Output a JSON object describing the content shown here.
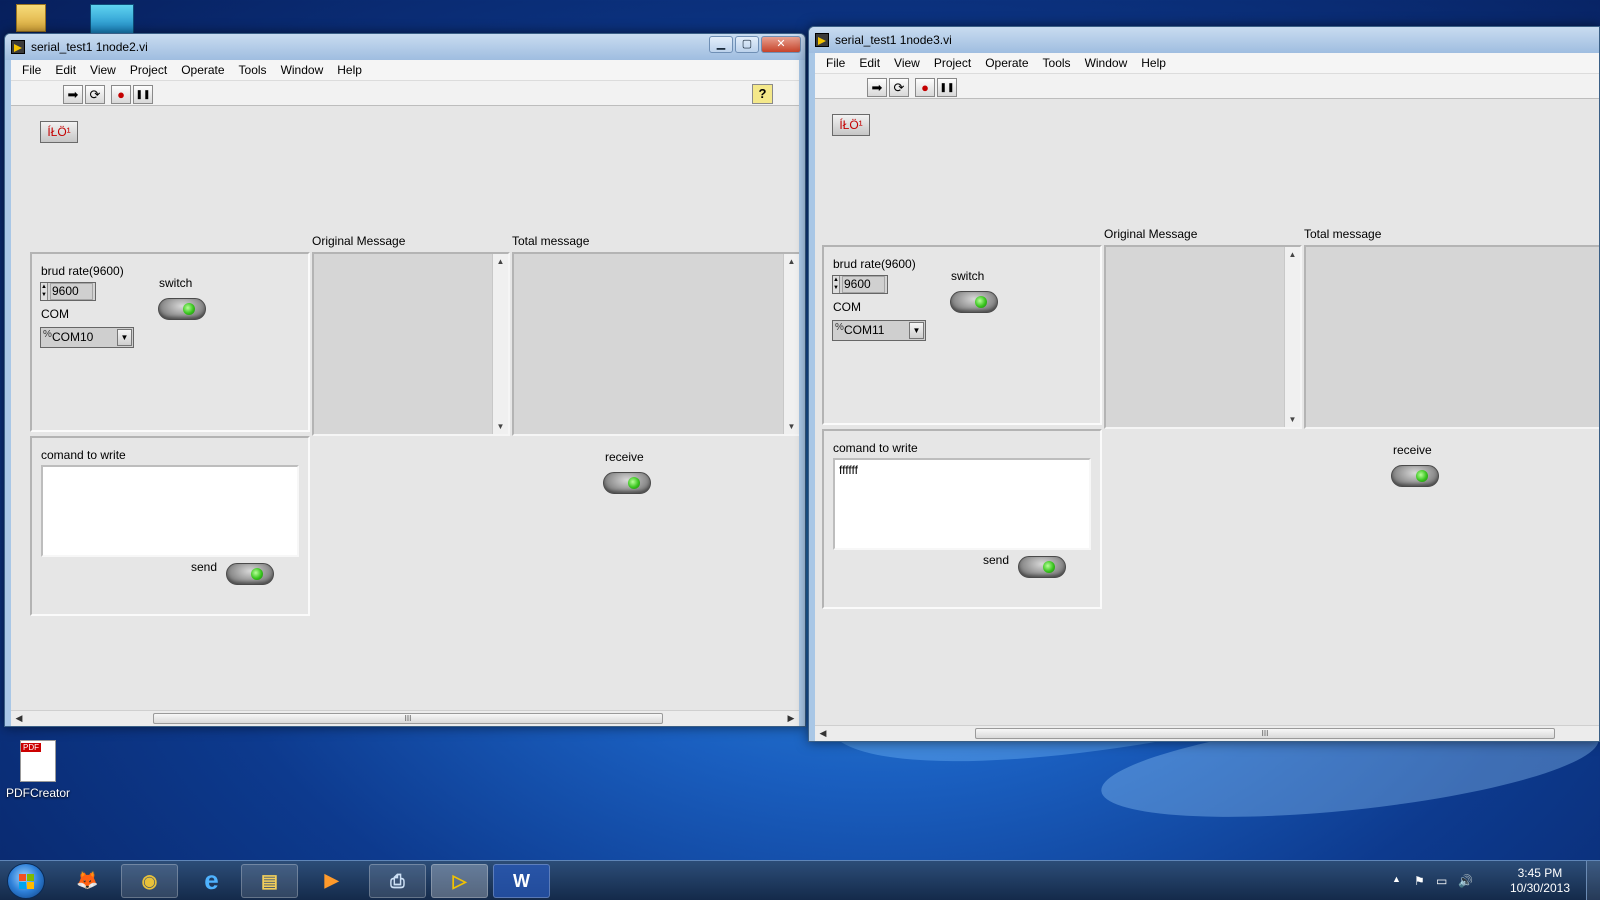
{
  "desktop": {
    "icons": [
      {
        "label": "PDFCreator",
        "badge": "PDF"
      }
    ]
  },
  "windows": [
    {
      "title": "serial_test1 1node2.vi",
      "caption_buttons": {
        "minimize": "▁",
        "maximize": "▢",
        "close": "✕"
      },
      "menu": [
        "File",
        "Edit",
        "View",
        "Project",
        "Operate",
        "Tools",
        "Window",
        "Help"
      ],
      "toolbar": {
        "run": "➡",
        "run_continuous": "⟳",
        "abort": "●",
        "pause": "❚❚",
        "help": "?"
      },
      "stop_button_label": "ÍŁÖ¹",
      "config": {
        "baud_label": "brud rate(9600)",
        "baud_value": "9600",
        "switch_label": "switch",
        "com_label": "COM",
        "com_value": "COM10"
      },
      "original_message_label": "Original Message",
      "total_message_label": "Total message",
      "write": {
        "label": "comand to write",
        "value": "",
        "send_label": "send"
      },
      "receive_label": "receive",
      "scroll_thumb": "III"
    },
    {
      "title": "serial_test1 1node3.vi",
      "menu": [
        "File",
        "Edit",
        "View",
        "Project",
        "Operate",
        "Tools",
        "Window",
        "Help"
      ],
      "toolbar": {
        "run": "➡",
        "run_continuous": "⟳",
        "abort": "●",
        "pause": "❚❚"
      },
      "stop_button_label": "ÍŁÖ¹",
      "config": {
        "baud_label": "brud rate(9600)",
        "baud_value": "9600",
        "switch_label": "switch",
        "com_label": "COM",
        "com_value": "COM11"
      },
      "original_message_label": "Original Message",
      "total_message_label": "Total message",
      "write": {
        "label": "comand to write",
        "value": "ffffff",
        "send_label": "send"
      },
      "receive_label": "receive",
      "scroll_thumb": "III"
    }
  ],
  "taskbar": {
    "apps": [
      {
        "icon": "firefox-icon",
        "glyph": "🦊"
      },
      {
        "icon": "chrome-icon",
        "glyph": "◉"
      },
      {
        "icon": "internet-explorer-icon",
        "glyph": "e"
      },
      {
        "icon": "file-explorer-icon",
        "glyph": "▤"
      },
      {
        "icon": "media-player-icon",
        "glyph": "▶"
      },
      {
        "icon": "network-printer-icon",
        "glyph": "⎙"
      },
      {
        "icon": "labview-icon",
        "glyph": "▷"
      },
      {
        "icon": "word-icon",
        "glyph": "W"
      }
    ],
    "time": "3:45 PM",
    "date": "10/30/2013",
    "tray_chevron": "▲",
    "tray_flag": "⚑",
    "tray_network": "▭",
    "tray_volume": "🔊"
  },
  "colors": {
    "led_green": "#38c41d",
    "stop_text": "#c40000",
    "panel_bg": "#e6e6e6"
  }
}
